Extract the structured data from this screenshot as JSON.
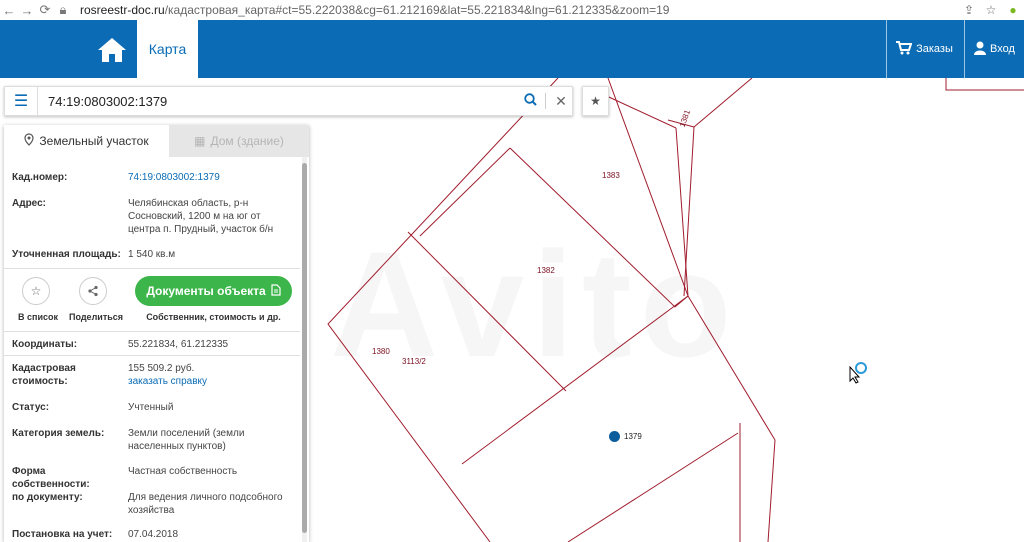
{
  "browser": {
    "url_host": "rosreestr-doc.ru",
    "url_path": "/кадастровая_карта#ct=55.222038&cg=61.212169&lat=55.221834&lng=61.212335&zoom=19"
  },
  "header": {
    "map_tab": "Карта",
    "orders_label": "Заказы",
    "login_label": "Вход"
  },
  "search": {
    "value": "74:19:0803002:1379"
  },
  "panel": {
    "tab_land": "Земельный участок",
    "tab_house": "Дом (здание)",
    "cad_num_label": "Кад.номер:",
    "cad_num_value": "74:19:0803002:1379",
    "address_label": "Адрес:",
    "address_value": "Челябинская область, р-н Сосновский, 1200 м на юг от центра п. Прудный, участок б/н",
    "area_label": "Уточненная площадь:",
    "area_value": "1 540 кв.м",
    "action_list": "В список",
    "action_share": "Поделиться",
    "docs_button": "Документы объекта",
    "docs_sub": "Собственник, стоимость и др.",
    "coords_label": "Координаты:",
    "coords_value": "55.221834, 61.212335",
    "cost_label": "Кадастровая стоимость:",
    "cost_value": "155 509.2 руб.",
    "cost_link": "заказать справку",
    "status_label": "Статус:",
    "status_value": "Учтенный",
    "category_label": "Категория земель:",
    "category_value": "Земли поселений (земли населенных пунктов)",
    "ownership_label": "Форма собственности:",
    "ownership_value": "Частная собственность",
    "doc_label": "по документу:",
    "doc_value": "Для ведения личного подсобного хозяйства",
    "registered_label": "Постановка на учет:",
    "registered_value": "07.04.2018"
  },
  "map": {
    "parcels": [
      "1383",
      "1382",
      "1380",
      "3113/2",
      "1381",
      "1379"
    ],
    "watermark": "Avito",
    "boundary_color": "#a01c2c",
    "marker_color": "#0b5d9c"
  },
  "colors": {
    "header_bg": "#0b6cb5",
    "docs_button_bg": "#3cb54a",
    "link": "#0b6cb5"
  }
}
